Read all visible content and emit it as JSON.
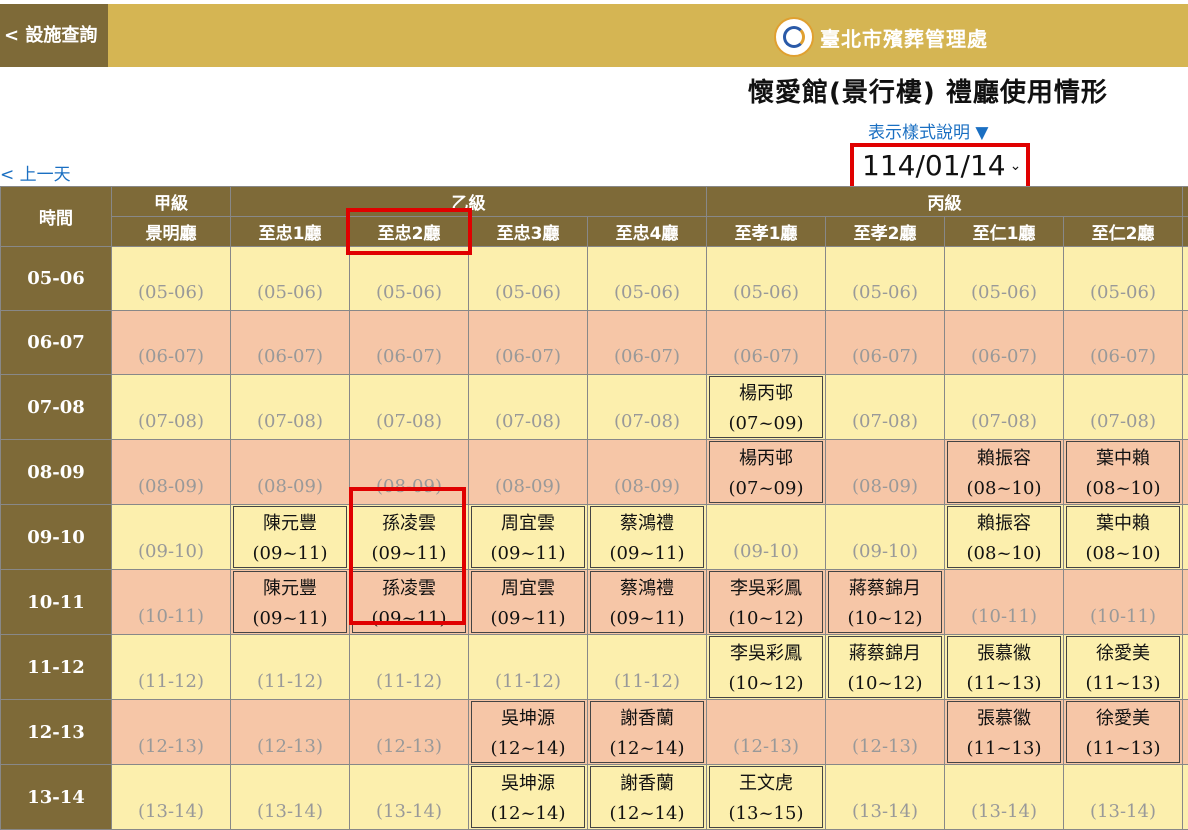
{
  "header": {
    "back_label": "< 設施查詢",
    "org_name": "臺北市殯葬管理處",
    "accent_color": "#d5b553",
    "dark_color": "#7e6a38"
  },
  "page": {
    "title": "懷愛館(景行樓) 禮廳使用情形",
    "legend_link": "表示樣式說明 ▼",
    "prev_day": "< 上一天",
    "date_value": "114/01/14"
  },
  "table": {
    "time_header": "時間",
    "groups": [
      "甲級",
      "乙級",
      "丙級"
    ],
    "halls": [
      "景明廳",
      "至忠1廳",
      "至忠2廳",
      "至忠3廳",
      "至忠4廳",
      "至孝1廳",
      "至孝2廳",
      "至仁1廳",
      "至仁2廳"
    ],
    "rows": [
      {
        "time": "05-06",
        "tone": "light",
        "cells": [
          {
            "text": "(05-06)"
          },
          {
            "text": "(05-06)"
          },
          {
            "text": "(05-06)"
          },
          {
            "text": "(05-06)"
          },
          {
            "text": "(05-06)"
          },
          {
            "text": "(05-06)"
          },
          {
            "text": "(05-06)"
          },
          {
            "text": "(05-06)"
          },
          {
            "text": "(05-06)"
          }
        ]
      },
      {
        "time": "06-07",
        "tone": "dark",
        "cells": [
          {
            "text": "(06-07)"
          },
          {
            "text": "(06-07)"
          },
          {
            "text": "(06-07)"
          },
          {
            "text": "(06-07)"
          },
          {
            "text": "(06-07)"
          },
          {
            "text": "(06-07)"
          },
          {
            "text": "(06-07)"
          },
          {
            "text": "(06-07)"
          },
          {
            "text": "(06-07)"
          }
        ]
      },
      {
        "time": "07-08",
        "tone": "light",
        "cells": [
          {
            "text": "(07-08)"
          },
          {
            "text": "(07-08)"
          },
          {
            "text": "(07-08)"
          },
          {
            "text": "(07-08)"
          },
          {
            "text": "(07-08)"
          },
          {
            "name": "楊丙邨",
            "range": "(07~09)"
          },
          {
            "text": "(07-08)"
          },
          {
            "text": "(07-08)"
          },
          {
            "text": "(07-08)"
          }
        ]
      },
      {
        "time": "08-09",
        "tone": "dark",
        "cells": [
          {
            "text": "(08-09)"
          },
          {
            "text": "(08-09)"
          },
          {
            "text": "(08-09)"
          },
          {
            "text": "(08-09)"
          },
          {
            "text": "(08-09)"
          },
          {
            "name": "楊丙邨",
            "range": "(07~09)"
          },
          {
            "text": "(08-09)"
          },
          {
            "name": "賴振容",
            "range": "(08~10)"
          },
          {
            "name": "葉中賴",
            "range": "(08~10)"
          }
        ]
      },
      {
        "time": "09-10",
        "tone": "light",
        "cells": [
          {
            "text": "(09-10)"
          },
          {
            "name": "陳元豐",
            "range": "(09~11)"
          },
          {
            "name": "孫凌雲",
            "range": "(09~11)"
          },
          {
            "name": "周宜雲",
            "range": "(09~11)"
          },
          {
            "name": "蔡鴻禮",
            "range": "(09~11)"
          },
          {
            "text": "(09-10)"
          },
          {
            "text": "(09-10)"
          },
          {
            "name": "賴振容",
            "range": "(08~10)"
          },
          {
            "name": "葉中賴",
            "range": "(08~10)"
          }
        ]
      },
      {
        "time": "10-11",
        "tone": "dark",
        "cells": [
          {
            "text": "(10-11)"
          },
          {
            "name": "陳元豐",
            "range": "(09~11)"
          },
          {
            "name": "孫凌雲",
            "range": "(09~11)"
          },
          {
            "name": "周宜雲",
            "range": "(09~11)"
          },
          {
            "name": "蔡鴻禮",
            "range": "(09~11)"
          },
          {
            "name": "李吳彩鳳",
            "range": "(10~12)"
          },
          {
            "name": "蔣蔡錦月",
            "range": "(10~12)"
          },
          {
            "text": "(10-11)"
          },
          {
            "text": "(10-11)"
          }
        ]
      },
      {
        "time": "11-12",
        "tone": "light",
        "cells": [
          {
            "text": "(11-12)"
          },
          {
            "text": "(11-12)"
          },
          {
            "text": "(11-12)"
          },
          {
            "text": "(11-12)"
          },
          {
            "text": "(11-12)"
          },
          {
            "name": "李吳彩鳳",
            "range": "(10~12)"
          },
          {
            "name": "蔣蔡錦月",
            "range": "(10~12)"
          },
          {
            "name": "張慕徽",
            "range": "(11~13)"
          },
          {
            "name": "徐愛美",
            "range": "(11~13)"
          }
        ]
      },
      {
        "time": "12-13",
        "tone": "dark",
        "cells": [
          {
            "text": "(12-13)"
          },
          {
            "text": "(12-13)"
          },
          {
            "text": "(12-13)"
          },
          {
            "name": "吳坤源",
            "range": "(12~14)"
          },
          {
            "name": "謝香蘭",
            "range": "(12~14)"
          },
          {
            "text": "(12-13)"
          },
          {
            "text": "(12-13)"
          },
          {
            "name": "張慕徽",
            "range": "(11~13)"
          },
          {
            "name": "徐愛美",
            "range": "(11~13)"
          }
        ]
      },
      {
        "time": "13-14",
        "tone": "light",
        "cells": [
          {
            "text": "(13-14)"
          },
          {
            "text": "(13-14)"
          },
          {
            "text": "(13-14)"
          },
          {
            "name": "吳坤源",
            "range": "(12~14)"
          },
          {
            "name": "謝香蘭",
            "range": "(12~14)"
          },
          {
            "name": "王文虎",
            "range": "(13~15)"
          },
          {
            "text": "(13-14)"
          },
          {
            "text": "(13-14)"
          },
          {
            "text": "(13-14)"
          }
        ]
      }
    ]
  }
}
